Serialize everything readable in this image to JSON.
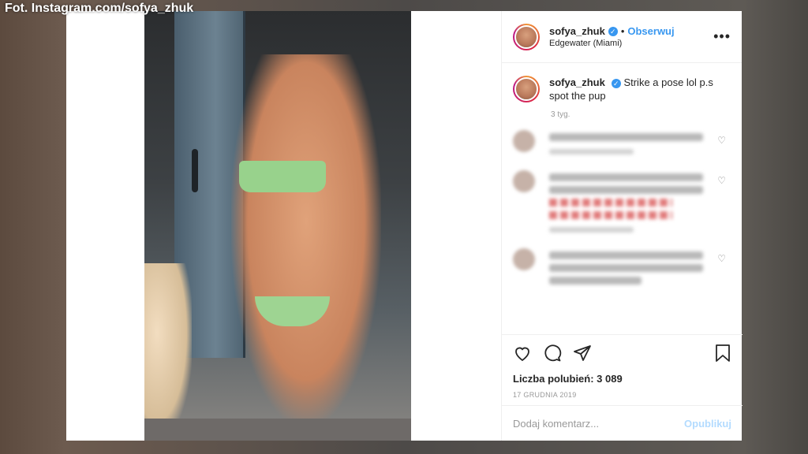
{
  "watermark": "Fot. Instagram.com/sofya_zhuk",
  "post": {
    "username": "sofya_zhuk",
    "separator": "•",
    "follow_label": "Obserwuj",
    "location": "Edgewater (Miami)",
    "more_icon": "more-horizontal-icon"
  },
  "caption": {
    "username": "sofya_zhuk",
    "text": "Strike a pose lol p.s spot the pup",
    "time_ago": "3 tyg."
  },
  "actions": {
    "likes": "Liczba polubień: 3 089",
    "date": "17 GRUDNIA 2019"
  },
  "add_comment": {
    "placeholder": "Dodaj komentarz...",
    "publish_label": "Opublikuj"
  },
  "colors": {
    "link_blue": "#3897f0",
    "publish_disabled": "#b3dbff"
  }
}
